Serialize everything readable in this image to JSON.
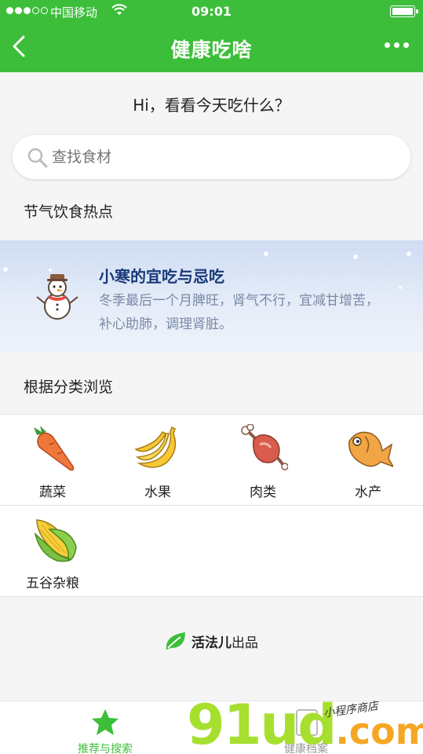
{
  "status_bar": {
    "carrier": "中国移动",
    "time": "09:01"
  },
  "nav": {
    "title": "健康吃啥"
  },
  "greeting": "Hi，看看今天吃什么？",
  "search": {
    "placeholder": "查找食材"
  },
  "solar_term": {
    "section_title": "节气饮食热点",
    "title": "小寒的宜吃与忌吃",
    "description": "冬季最后一个月脾旺，肾气不行，宜减甘增苦，补心助肺，调理肾脏。"
  },
  "categories": {
    "section_title": "根据分类浏览",
    "items": [
      {
        "label": "蔬菜",
        "icon": "carrot-icon"
      },
      {
        "label": "水果",
        "icon": "banana-icon"
      },
      {
        "label": "肉类",
        "icon": "meat-icon"
      },
      {
        "label": "水产",
        "icon": "fish-icon"
      },
      {
        "label": "五谷杂粮",
        "icon": "corn-icon"
      }
    ]
  },
  "brand": {
    "name": "活法儿",
    "suffix": "出品"
  },
  "tabbar": {
    "tabs": [
      {
        "label": "推荐与搜索",
        "icon": "star-icon",
        "active": true
      },
      {
        "label": "健康档案",
        "icon": "record-icon",
        "active": false
      }
    ]
  },
  "watermark": {
    "text": "91ud",
    "domain": ".com",
    "subtitle": "小程序商店"
  },
  "colors": {
    "primary": "#3dbe3b",
    "banner_title": "#1a3a7a"
  }
}
